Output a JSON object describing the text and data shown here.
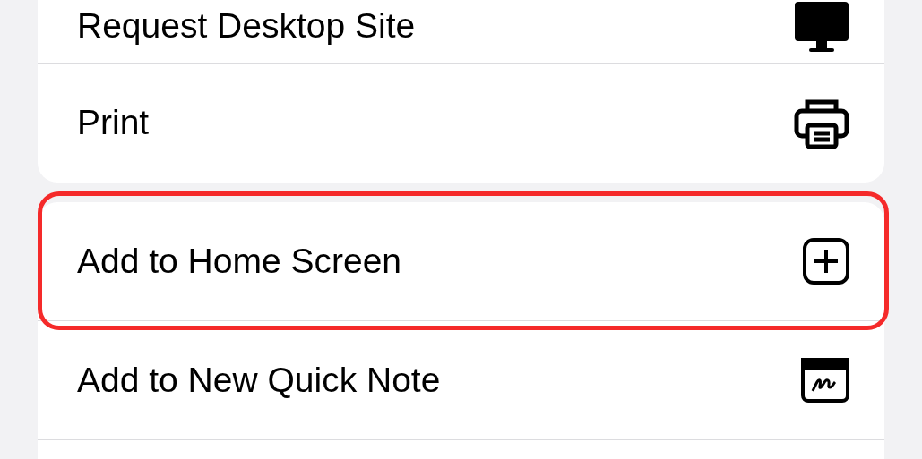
{
  "groups": [
    {
      "items": [
        {
          "label": "Request Desktop Site",
          "kind": "desktop",
          "highlighted": false
        },
        {
          "label": "Print",
          "kind": "printer",
          "highlighted": false
        }
      ]
    },
    {
      "items": [
        {
          "label": "Add to Home Screen",
          "kind": "add-square",
          "highlighted": true
        },
        {
          "label": "Add to New Quick Note",
          "kind": "quick-note",
          "highlighted": false
        }
      ]
    }
  ]
}
